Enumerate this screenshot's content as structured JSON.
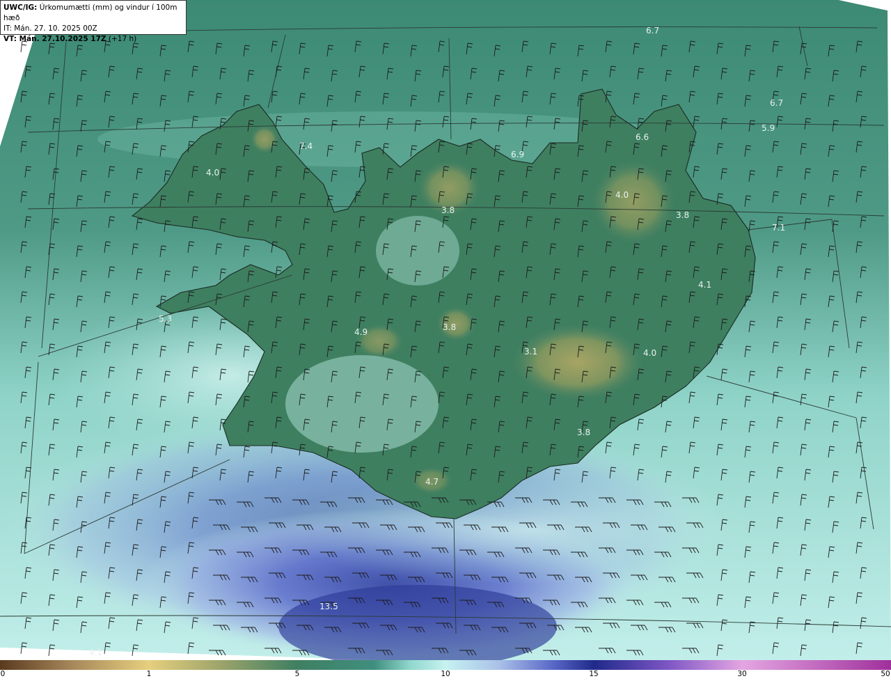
{
  "header": {
    "model": "UWC/IG:",
    "title": "Úrkomumætti (mm) og vindur í 100m hæð",
    "init_time": "IT: Mán. 27. 10. 2025 00Z",
    "valid_label": "VT: Mán. 27.10.2025 17Z",
    "lead": "(+17 h)"
  },
  "colorbar": {
    "ticks": [
      "0",
      "1",
      "5",
      "10",
      "15",
      "30",
      "50"
    ],
    "colors": [
      "#5a3a1e",
      "#a6875a",
      "#e6cf7e",
      "#9aa36a",
      "#3f7f62",
      "#3f8f7e",
      "#8fd7cc",
      "#c6f2f0",
      "#aac1e8",
      "#5a68c8",
      "#1f2a8a",
      "#7e56c4",
      "#e4a6e2",
      "#a0309c"
    ]
  },
  "map_values": [
    "6.7",
    "6.7",
    "5.9",
    "6.6",
    "6.9",
    "7.4",
    "4.0",
    "4.0",
    "3.8",
    "3.8",
    "7.1",
    "4.1",
    "5.3",
    "4.9",
    "3.8",
    "3.1",
    "4.0",
    "3.8",
    "4.7",
    "13.5",
    "4.1"
  ],
  "colors": {
    "sea_green": "#4f9a86",
    "land_green": "#3d7a5d",
    "highland": "#8d9b62",
    "sea_light": "#bdeae6",
    "blue": "#7d8fdc",
    "deep_blue": "#2f3c9e"
  }
}
